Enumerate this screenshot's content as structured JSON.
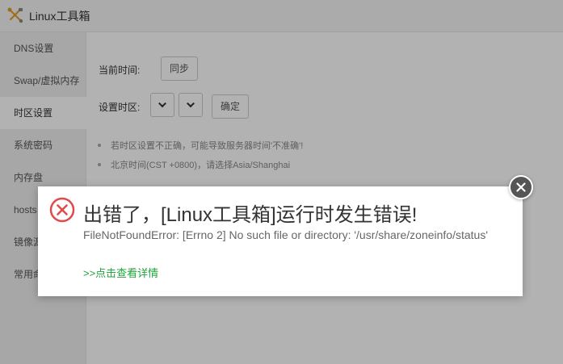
{
  "app": {
    "title": "Linux工具箱"
  },
  "sidebar": {
    "items": [
      {
        "label": "DNS设置",
        "active": false
      },
      {
        "label": "Swap/虚拟内存",
        "active": false
      },
      {
        "label": "时区设置",
        "active": true
      },
      {
        "label": "系统密码",
        "active": false
      },
      {
        "label": "内存盘",
        "active": false
      },
      {
        "label": "hosts",
        "active": false
      },
      {
        "label": "镜像源",
        "active": false
      },
      {
        "label": "常用命",
        "active": false
      }
    ]
  },
  "timezone": {
    "current_time_label": "当前时间:",
    "sync_button": "同步",
    "set_zone_label": "设置时区:",
    "confirm_button": "确定",
    "tips": [
      "若时区设置不正确，可能导致服务器时间'不准确'!",
      "北京时间(CST +0800)，请选择Asia/Shanghai"
    ]
  },
  "error_dialog": {
    "title": "出错了，[Linux工具箱]运行时发生错误!",
    "message": "FileNotFoundError: [Errno 2] No such file or directory: '/usr/share/zoneinfo/status'",
    "details_link": ">>点击查看详情",
    "icon": "error-x-circle-icon",
    "close_icon": "close-icon"
  },
  "colors": {
    "accent_green": "#20a53a",
    "error_red": "#e04a4a",
    "overlay": "rgba(0,0,0,0.30)"
  }
}
